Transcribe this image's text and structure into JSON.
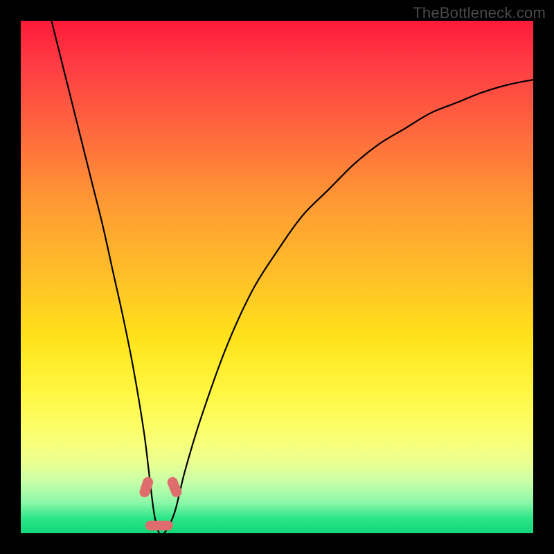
{
  "watermark": "TheBottleneck.com",
  "chart_data": {
    "type": "line",
    "title": "",
    "xlabel": "",
    "ylabel": "",
    "xlim": [
      0,
      100
    ],
    "ylim": [
      0,
      100
    ],
    "series": [
      {
        "name": "bottleneck-curve",
        "x": [
          6,
          8,
          10,
          12,
          14,
          16,
          18,
          20,
          22,
          24,
          25,
          26,
          27,
          28,
          30,
          32,
          35,
          40,
          45,
          50,
          55,
          60,
          65,
          70,
          75,
          80,
          85,
          90,
          95,
          100
        ],
        "y": [
          100,
          92,
          84,
          76,
          68,
          60,
          51,
          42,
          32,
          20,
          12,
          4,
          0,
          0,
          4,
          12,
          22,
          36,
          47,
          55,
          62,
          67,
          72,
          76,
          79,
          82,
          84,
          86,
          87.5,
          88.5
        ]
      }
    ],
    "annotations": [
      {
        "name": "marker-left",
        "x": 24.5,
        "y": 9
      },
      {
        "name": "marker-right",
        "x": 30.0,
        "y": 9
      },
      {
        "name": "marker-bottom",
        "x": 27.0,
        "y": 1.5
      }
    ],
    "colors": {
      "curve": "#000000",
      "marker": "#e06d6d",
      "gradient_top": "#ff1a3a",
      "gradient_bottom": "#12d67a"
    }
  }
}
